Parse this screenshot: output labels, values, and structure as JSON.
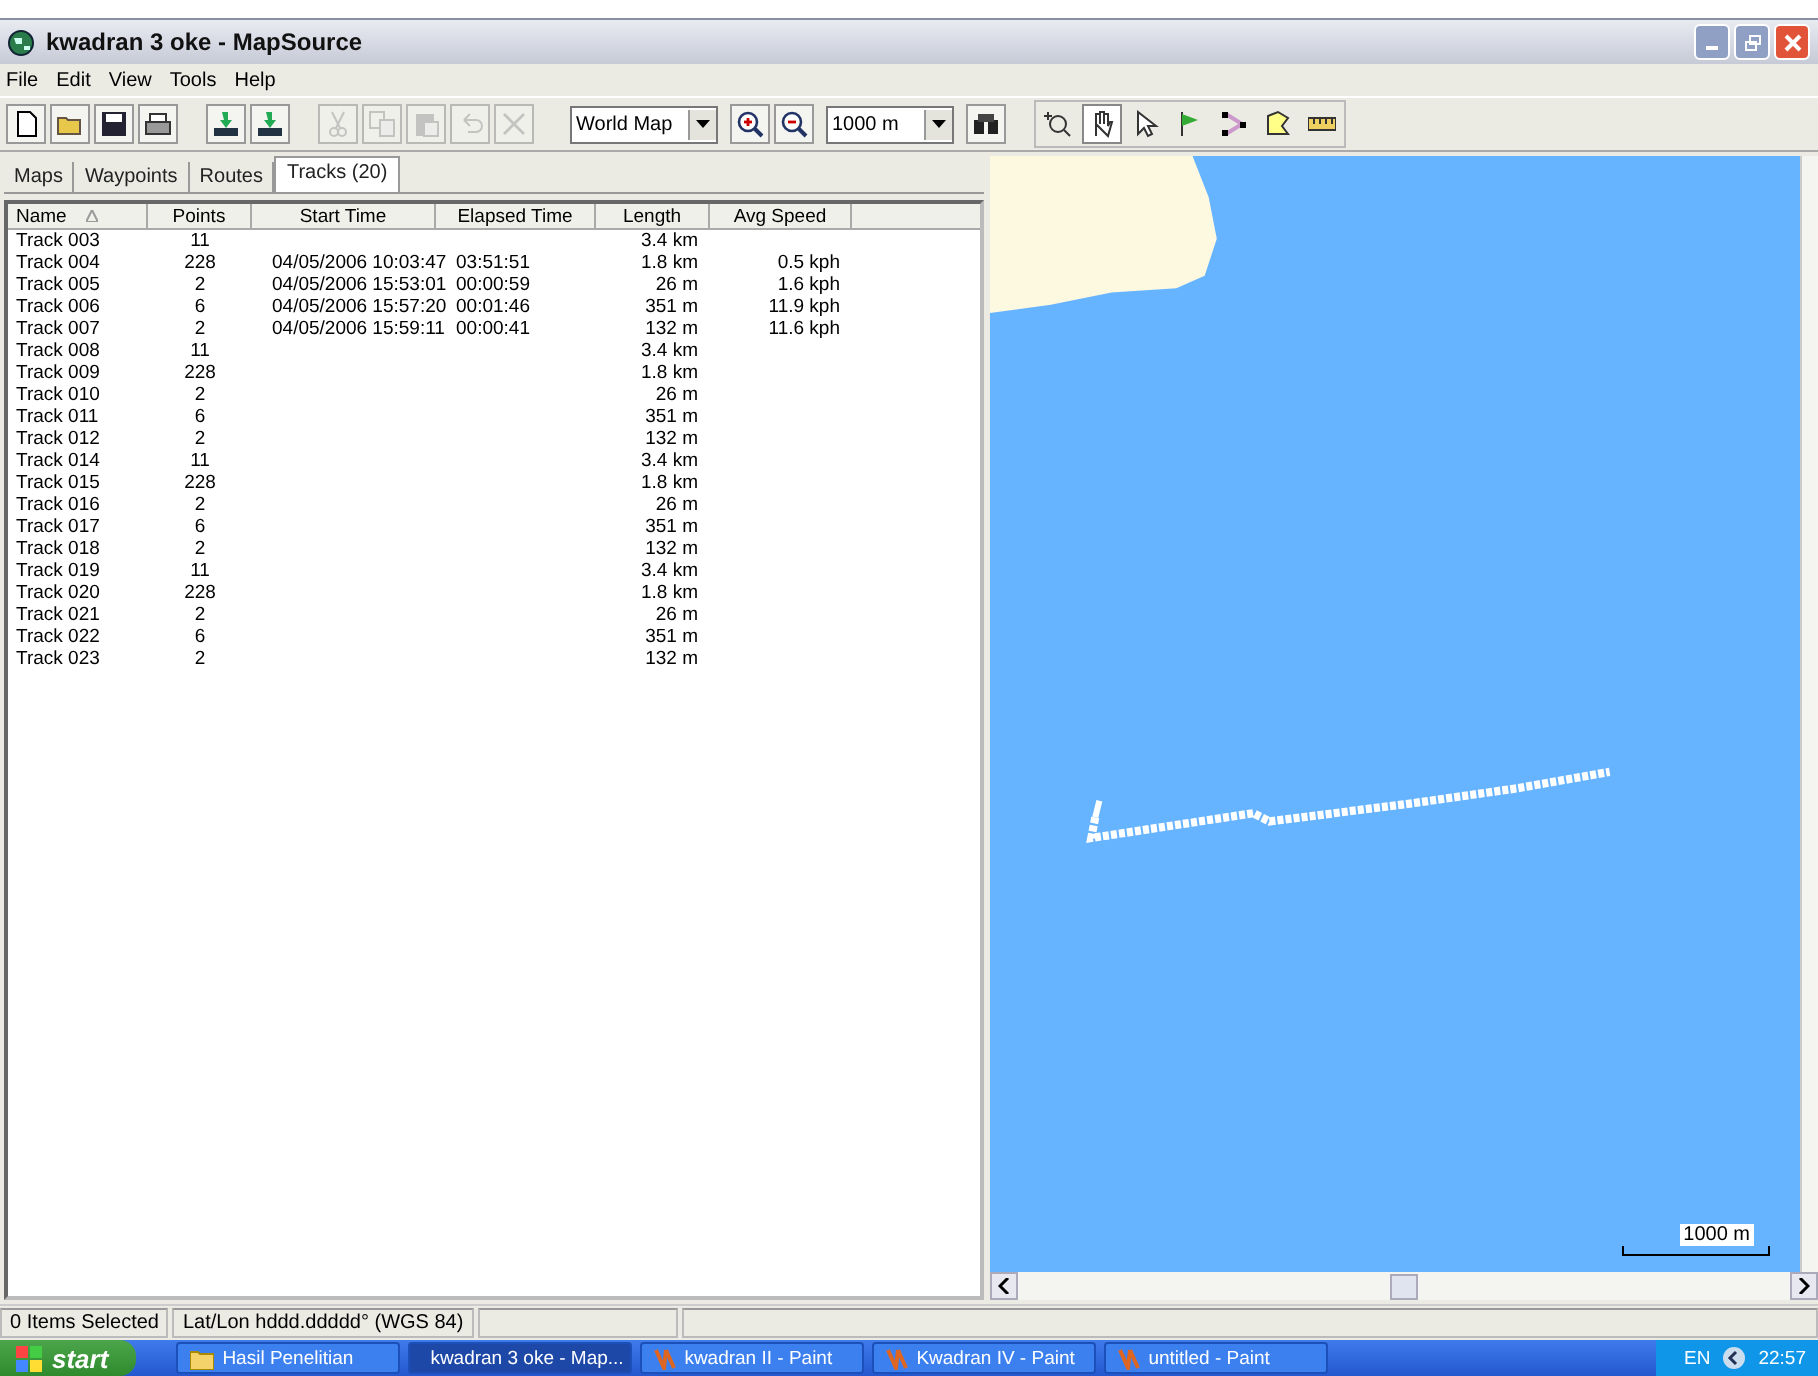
{
  "window": {
    "title": "kwadran 3 oke - MapSource"
  },
  "menu": [
    "File",
    "Edit",
    "View",
    "Tools",
    "Help"
  ],
  "toolbar": [
    {
      "kind": "new",
      "disabled": false
    },
    {
      "kind": "open",
      "disabled": false
    },
    {
      "kind": "save",
      "disabled": false
    },
    {
      "kind": "print",
      "disabled": false
    },
    {
      "kind": "receive",
      "disabled": false
    },
    {
      "kind": "send",
      "disabled": false
    },
    {
      "kind": "cut",
      "disabled": true
    },
    {
      "kind": "copy",
      "disabled": true
    },
    {
      "kind": "paste",
      "disabled": true
    },
    {
      "kind": "undo",
      "disabled": true
    },
    {
      "kind": "delete",
      "disabled": true
    }
  ],
  "map_dropdown": {
    "value": "World Map"
  },
  "zoom_buttons": [
    {
      "kind": "zoomin"
    },
    {
      "kind": "zoomout"
    }
  ],
  "scale_dropdown": {
    "value": "1000 m"
  },
  "tools": [
    {
      "kind": "zoom",
      "selected": false
    },
    {
      "kind": "hand",
      "selected": true
    },
    {
      "kind": "pointer",
      "selected": false
    },
    {
      "kind": "flag",
      "selected": false
    },
    {
      "kind": "route",
      "selected": false
    },
    {
      "kind": "area",
      "selected": false
    },
    {
      "kind": "ruler",
      "selected": false
    }
  ],
  "tabs": [
    {
      "label": "Maps",
      "selected": false
    },
    {
      "label": "Waypoints",
      "selected": false
    },
    {
      "label": "Routes",
      "selected": false
    },
    {
      "label": "Tracks (20)",
      "selected": true
    }
  ],
  "table": {
    "columns": [
      "Name",
      "Points",
      "Start Time",
      "Elapsed Time",
      "Length",
      "Avg Speed"
    ],
    "rows": [
      [
        "Track 003",
        "11",
        "",
        "",
        "3.4 km",
        ""
      ],
      [
        "Track 004",
        "228",
        "04/05/2006 10:03:47",
        "03:51:51",
        "1.8 km",
        "0.5 kph"
      ],
      [
        "Track 005",
        "2",
        "04/05/2006 15:53:01",
        "00:00:59",
        "26 m",
        "1.6 kph"
      ],
      [
        "Track 006",
        "6",
        "04/05/2006 15:57:20",
        "00:01:46",
        "351 m",
        "11.9 kph"
      ],
      [
        "Track 007",
        "2",
        "04/05/2006 15:59:11",
        "00:00:41",
        "132 m",
        "11.6 kph"
      ],
      [
        "Track 008",
        "11",
        "",
        "",
        "3.4 km",
        ""
      ],
      [
        "Track 009",
        "228",
        "",
        "",
        "1.8 km",
        ""
      ],
      [
        "Track 010",
        "2",
        "",
        "",
        "26 m",
        ""
      ],
      [
        "Track 011",
        "6",
        "",
        "",
        "351 m",
        ""
      ],
      [
        "Track 012",
        "2",
        "",
        "",
        "132 m",
        ""
      ],
      [
        "Track 014",
        "11",
        "",
        "",
        "3.4 km",
        ""
      ],
      [
        "Track 015",
        "228",
        "",
        "",
        "1.8 km",
        ""
      ],
      [
        "Track 016",
        "2",
        "",
        "",
        "26 m",
        ""
      ],
      [
        "Track 017",
        "6",
        "",
        "",
        "351 m",
        ""
      ],
      [
        "Track 018",
        "2",
        "",
        "",
        "132 m",
        ""
      ],
      [
        "Track 019",
        "11",
        "",
        "",
        "3.4 km",
        ""
      ],
      [
        "Track 020",
        "228",
        "",
        "",
        "1.8 km",
        ""
      ],
      [
        "Track 021",
        "2",
        "",
        "",
        "26 m",
        ""
      ],
      [
        "Track 022",
        "6",
        "",
        "",
        "351 m",
        ""
      ],
      [
        "Track 023",
        "2",
        "",
        "",
        "132 m",
        ""
      ]
    ]
  },
  "map": {
    "scale_label": "1000 m"
  },
  "status_bar": [
    "0 Items Selected",
    "Lat/Lon hddd.ddddd° (WGS 84)"
  ],
  "taskbar": {
    "start": "start",
    "items": [
      {
        "label": "Hasil Penelitian",
        "kind": "folder",
        "selected": false
      },
      {
        "label": "kwadran 3 oke - Map...",
        "kind": "globe",
        "selected": true
      },
      {
        "label": "kwadran II - Paint",
        "kind": "paint",
        "selected": false
      },
      {
        "label": "Kwadran IV - Paint",
        "kind": "paint",
        "selected": false
      },
      {
        "label": "untitled - Paint",
        "kind": "paint",
        "selected": false
      }
    ],
    "language": "EN",
    "clock": "22:57"
  }
}
